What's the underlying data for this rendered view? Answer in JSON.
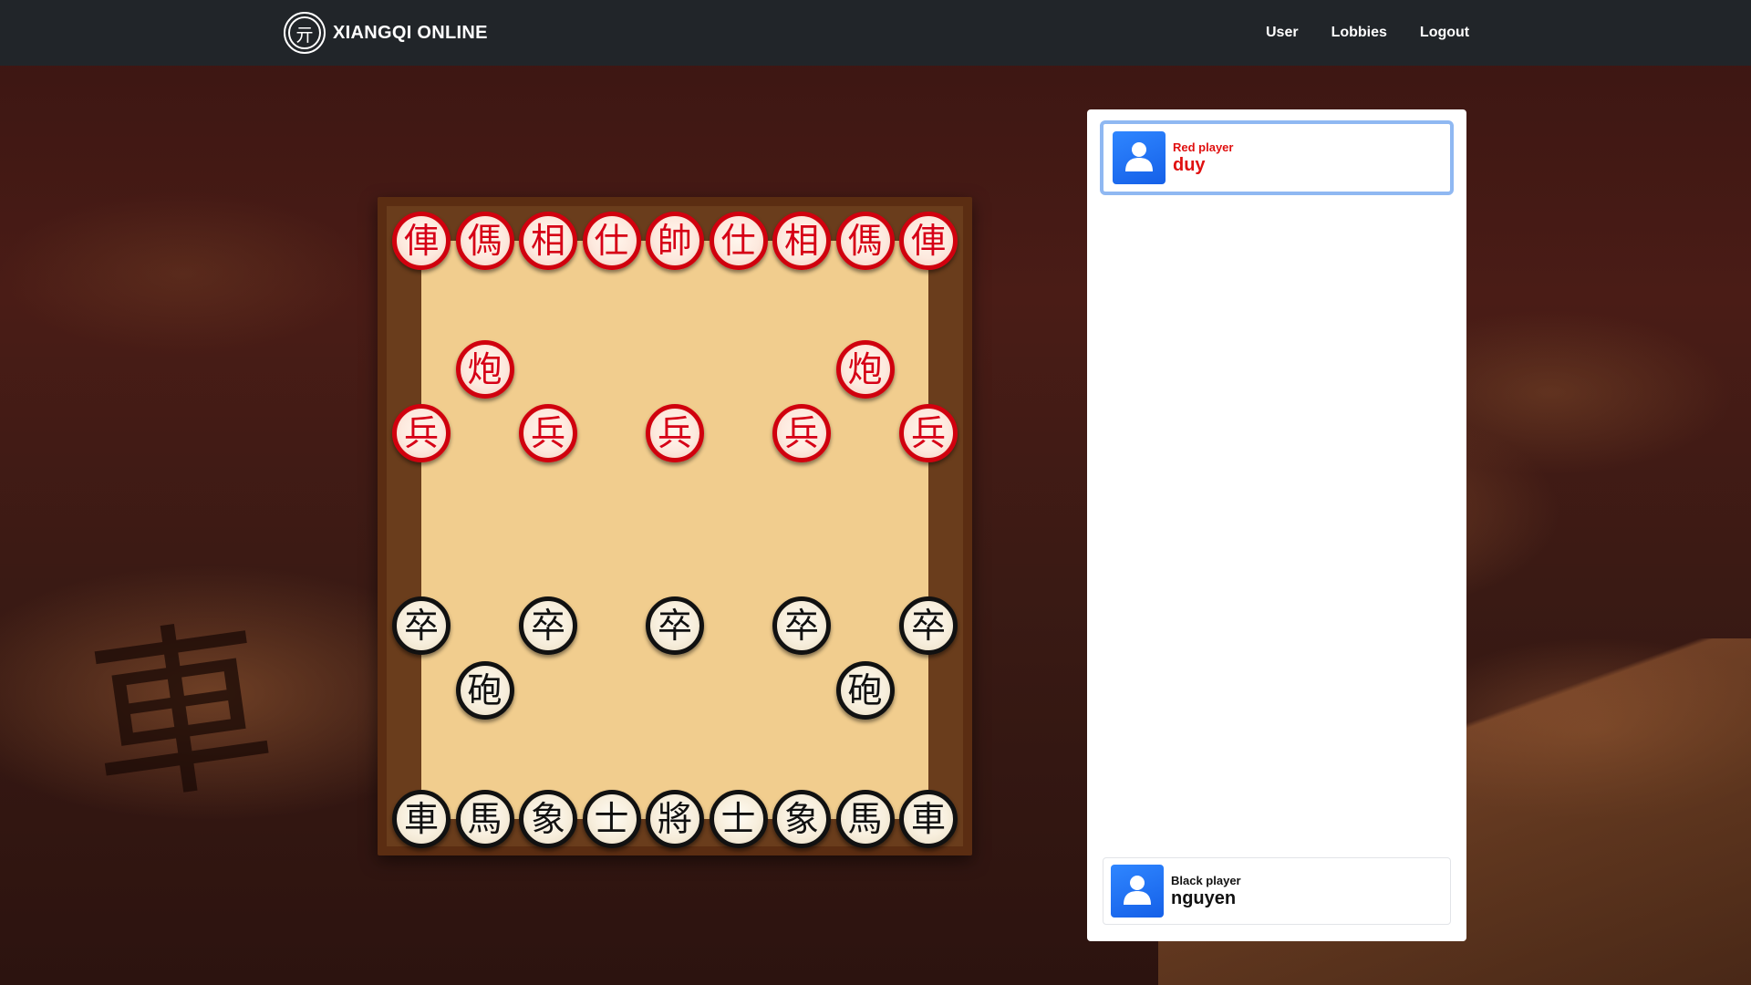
{
  "navbar": {
    "brand_logo_glyph": "亓",
    "brand_name": "XIANGQI ONLINE",
    "links": [
      {
        "label": "User"
      },
      {
        "label": "Lobbies"
      },
      {
        "label": "Logout"
      }
    ]
  },
  "background": {
    "glyph": "車"
  },
  "board": {
    "files": 9,
    "ranks": 10,
    "colors": {
      "line": "#b5532f",
      "field": "#f1cd8e",
      "frame": "#5b2d12",
      "red": "#d60016",
      "black": "#111111"
    },
    "pieces": [
      {
        "side": "red",
        "char": "俥",
        "col": 0,
        "row": 0
      },
      {
        "side": "red",
        "char": "傌",
        "col": 1,
        "row": 0
      },
      {
        "side": "red",
        "char": "相",
        "col": 2,
        "row": 0
      },
      {
        "side": "red",
        "char": "仕",
        "col": 3,
        "row": 0
      },
      {
        "side": "red",
        "char": "帥",
        "col": 4,
        "row": 0
      },
      {
        "side": "red",
        "char": "仕",
        "col": 5,
        "row": 0
      },
      {
        "side": "red",
        "char": "相",
        "col": 6,
        "row": 0
      },
      {
        "side": "red",
        "char": "傌",
        "col": 7,
        "row": 0
      },
      {
        "side": "red",
        "char": "俥",
        "col": 8,
        "row": 0
      },
      {
        "side": "red",
        "char": "炮",
        "col": 1,
        "row": 2
      },
      {
        "side": "red",
        "char": "炮",
        "col": 7,
        "row": 2
      },
      {
        "side": "red",
        "char": "兵",
        "col": 0,
        "row": 3
      },
      {
        "side": "red",
        "char": "兵",
        "col": 2,
        "row": 3
      },
      {
        "side": "red",
        "char": "兵",
        "col": 4,
        "row": 3
      },
      {
        "side": "red",
        "char": "兵",
        "col": 6,
        "row": 3
      },
      {
        "side": "red",
        "char": "兵",
        "col": 8,
        "row": 3
      },
      {
        "side": "black",
        "char": "卒",
        "col": 0,
        "row": 6
      },
      {
        "side": "black",
        "char": "卒",
        "col": 2,
        "row": 6
      },
      {
        "side": "black",
        "char": "卒",
        "col": 4,
        "row": 6
      },
      {
        "side": "black",
        "char": "卒",
        "col": 6,
        "row": 6
      },
      {
        "side": "black",
        "char": "卒",
        "col": 8,
        "row": 6
      },
      {
        "side": "black",
        "char": "砲",
        "col": 1,
        "row": 7
      },
      {
        "side": "black",
        "char": "砲",
        "col": 7,
        "row": 7
      },
      {
        "side": "black",
        "char": "車",
        "col": 0,
        "row": 9
      },
      {
        "side": "black",
        "char": "馬",
        "col": 1,
        "row": 9
      },
      {
        "side": "black",
        "char": "象",
        "col": 2,
        "row": 9
      },
      {
        "side": "black",
        "char": "士",
        "col": 3,
        "row": 9
      },
      {
        "side": "black",
        "char": "將",
        "col": 4,
        "row": 9
      },
      {
        "side": "black",
        "char": "士",
        "col": 5,
        "row": 9
      },
      {
        "side": "black",
        "char": "象",
        "col": 6,
        "row": 9
      },
      {
        "side": "black",
        "char": "馬",
        "col": 7,
        "row": 9
      },
      {
        "side": "black",
        "char": "車",
        "col": 8,
        "row": 9
      }
    ]
  },
  "players": {
    "red": {
      "role": "Red player",
      "name": "duy",
      "active": true
    },
    "black": {
      "role": "Black player",
      "name": "nguyen",
      "active": false
    }
  }
}
